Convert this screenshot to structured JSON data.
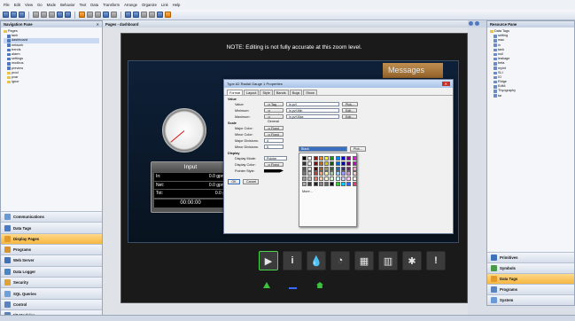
{
  "menu": [
    "File",
    "Edit",
    "View",
    "Go",
    "Mode",
    "Behavior",
    "Text",
    "Data",
    "Transform",
    "Arrange",
    "Organize",
    "Link",
    "Help"
  ],
  "left_pane": {
    "title": "Navigation Pane",
    "tree": [
      "Pages",
      "tank",
      "dashboard",
      "network",
      "trends",
      "alarm",
      "settings",
      "modbus",
      "preview",
      "prod",
      "pvar",
      "ignor"
    ],
    "buttons": [
      "Communications",
      "Data Tags",
      "Display Pages",
      "Programs",
      "Web Server",
      "Data Logger",
      "Security",
      "SQL Queries",
      "Control",
      "I/O Modules"
    ]
  },
  "doc_tab": "Pages - dashboard",
  "canvas": {
    "note": "NOTE: Editing is not fully accurate at this zoom level.",
    "messages_label": "Messages",
    "input_panel": {
      "title": "Input",
      "rows": [
        {
          "label": "In:",
          "value": "0.0 gpm"
        },
        {
          "label": "Net:",
          "value": "0.0 gpm"
        },
        {
          "label": "Tot:",
          "value": "0.0 g"
        }
      ],
      "time": "00:00:00"
    }
  },
  "dialog": {
    "title": "Type A2 Radial Gauge 1 Properties",
    "tabs": [
      "Format",
      "Layout",
      "Style",
      "Bands",
      "Bugs",
      "Show"
    ],
    "value_section": "Value",
    "value_rows": [
      {
        "label": "Value:",
        "mode": "Tag",
        "field": "in.pvf",
        "btn": "Pick..."
      },
      {
        "label": "Minimum:",
        "mode": "General",
        "field": "in.pvf.Min",
        "btn": "Edit..."
      },
      {
        "label": "Maximum:",
        "mode": "General",
        "field": "in.pvf.Max",
        "btn": "Edit..."
      }
    ],
    "scale_section": "Scale",
    "scale_rows": [
      {
        "label": "Major Color:",
        "mode": "Fixed"
      },
      {
        "label": "Minor Color:",
        "mode": "Fixed"
      },
      {
        "label": "Major Divisions:",
        "value": "4"
      },
      {
        "label": "Minor Divisions:",
        "value": "5"
      }
    ],
    "color_dropdown": "Black",
    "color_btn": "Pick...",
    "display_section": "Display",
    "display_rows": [
      {
        "label": "Display Mode:",
        "value": "Pointer"
      },
      {
        "label": "Display Color:",
        "mode": "Fixed"
      },
      {
        "label": "Pointer Style:",
        "value": ""
      }
    ],
    "palette_more": "More...",
    "ok": "OK",
    "cancel": "Cancel"
  },
  "right_pane": {
    "title": "Resource Pane",
    "tree": [
      "Data Tags",
      "setting",
      "mac",
      "in",
      "tank",
      "null",
      "leakage",
      "beta",
      "myint",
      "SLI",
      "IO",
      "Ridge",
      "Edit4",
      "Thyography",
      "tar"
    ],
    "buttons": [
      "Primitives",
      "Symbols",
      "Data Tags",
      "Programs",
      "System"
    ]
  },
  "colors": {
    "accent": "#f5b640",
    "screen_bg": "#1a1a1a",
    "messages": "#c98a3b",
    "gauge_needle": "#d11111"
  }
}
